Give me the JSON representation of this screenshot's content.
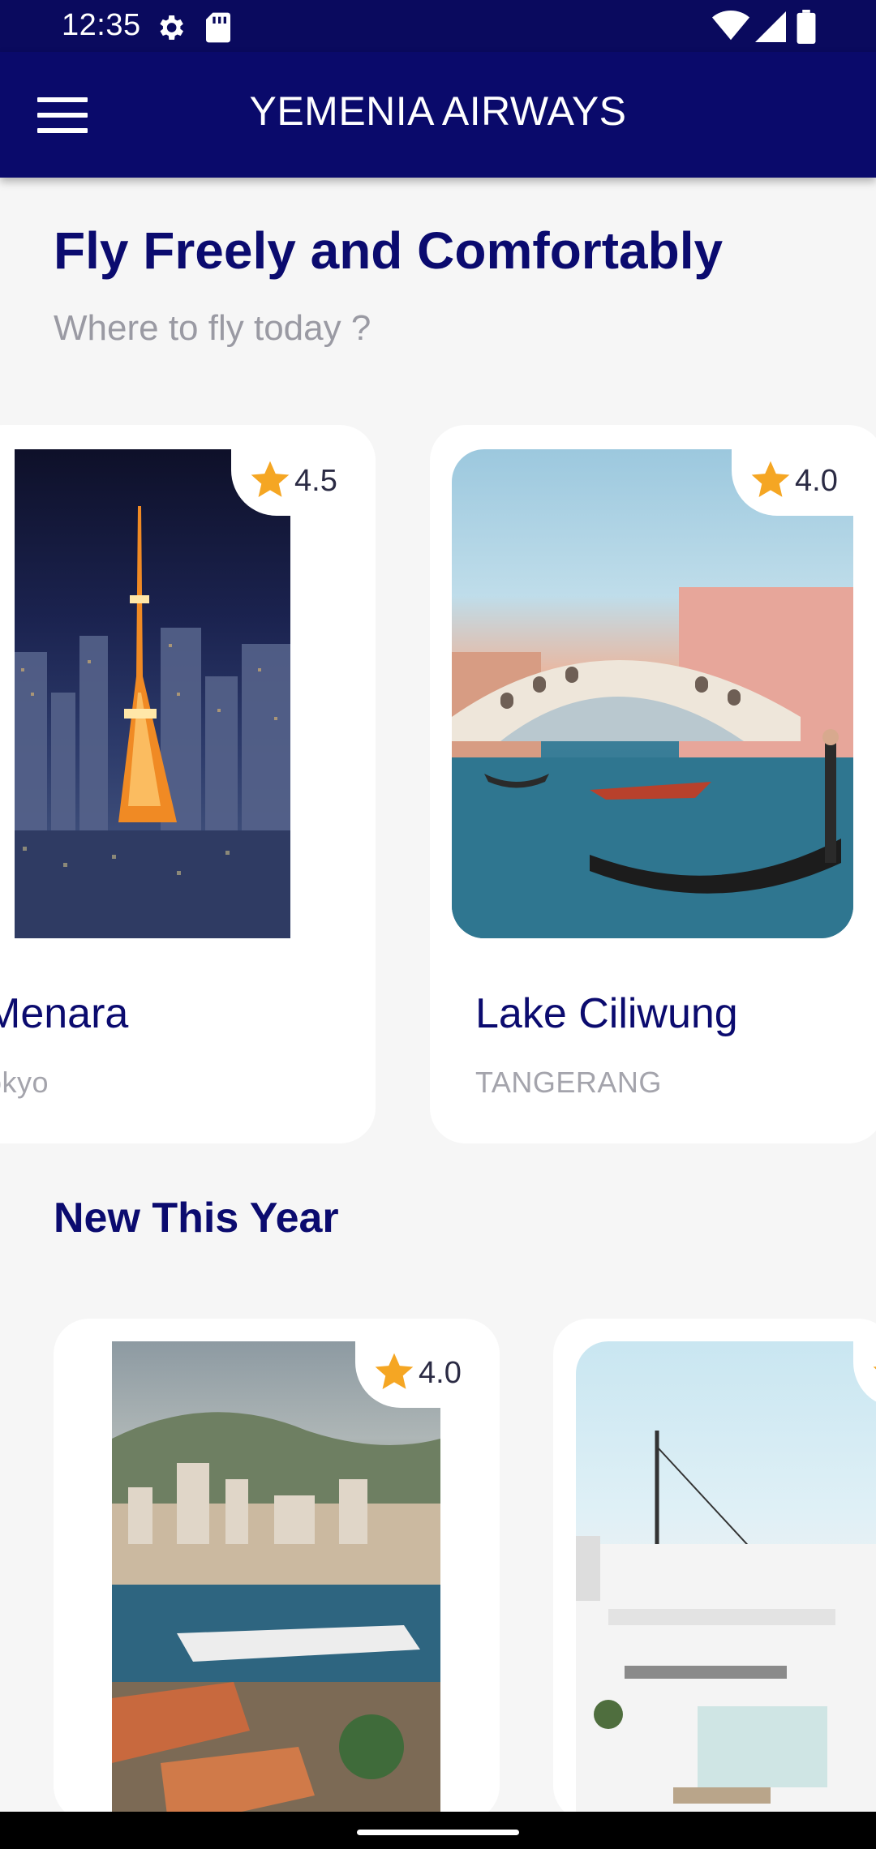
{
  "status_bar": {
    "time": "12:35"
  },
  "app_bar": {
    "title": "YEMENIA AIRWAYS"
  },
  "hero": {
    "headline": "Fly Freely and Comfortably",
    "subline": "Where to fly today ?"
  },
  "popular": [
    {
      "name": "Menara",
      "city": "okyo",
      "rating": "4.5"
    },
    {
      "name": "Lake Ciliwung",
      "city": "TANGERANG",
      "rating": "4.0"
    }
  ],
  "new_section": {
    "title": "New This Year",
    "items": [
      {
        "rating": "4.0"
      },
      {
        "rating": ""
      }
    ]
  },
  "colors": {
    "primary": "#0A0A6B",
    "accent_star": "#F5A623",
    "background": "#F6F6F6",
    "card": "#FFFFFF"
  },
  "icons": [
    "menu-icon",
    "settings-icon",
    "sd-card-icon",
    "wifi-icon",
    "signal-icon",
    "battery-icon",
    "star-icon"
  ]
}
